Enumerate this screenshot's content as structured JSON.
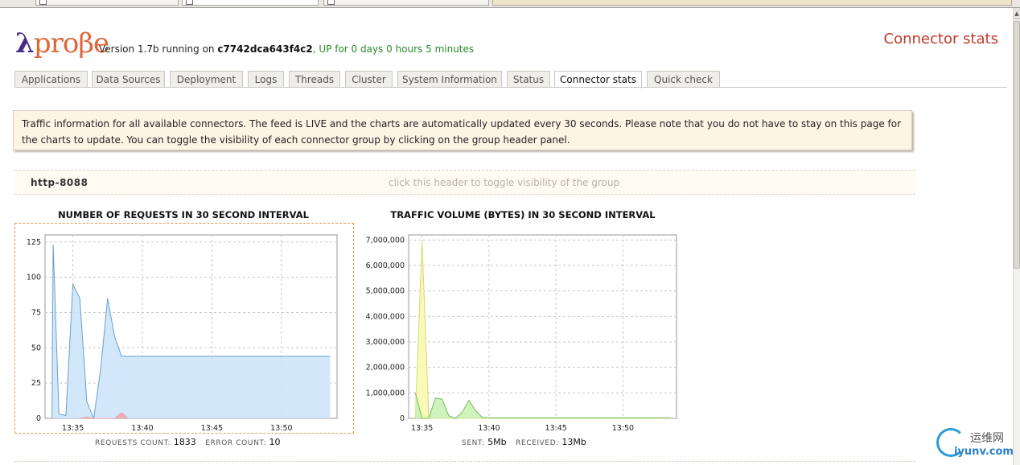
{
  "header": {
    "logo_lambda": "λ",
    "logo_rest": "proβe",
    "version_prefix": "Version 1.7b running on ",
    "host": "c7742dca643f4c2",
    "uptime": ", UP for 0 days 0 hours 5 minutes",
    "page_title": "Connector stats"
  },
  "tabs": [
    {
      "label": "Applications"
    },
    {
      "label": "Data Sources"
    },
    {
      "label": "Deployment"
    },
    {
      "label": "Logs"
    },
    {
      "label": "Threads"
    },
    {
      "label": "Cluster"
    },
    {
      "label": "System Information"
    },
    {
      "label": "Status"
    },
    {
      "label": "Connector stats",
      "active": true
    },
    {
      "label": "Quick check"
    }
  ],
  "info_text": "Traffic information for all available connectors. The feed is LIVE and the charts are automatically updated every 30 seconds. Please note that you do not have to stay on this page for the charts to update. You can toggle the visibility of each connector group by clicking on the group header panel.",
  "group": {
    "name": "http-8088",
    "hint": "click this header to toggle visibility of the group"
  },
  "requests_stats": {
    "count_label": "REQUESTS COUNT:",
    "count": "1833",
    "error_label": "ERROR COUNT:",
    "errors": "10"
  },
  "traffic_stats": {
    "sent_label": "SENT:",
    "sent": "5Mb",
    "received_label": "RECEIVED:",
    "received": "13Mb"
  },
  "colors": {
    "requests_fill": "#cde6fa",
    "requests_line": "#6aa0c8",
    "errors_fill": "#f0a0b0",
    "sent_fill": "#f8f8b0",
    "sent_line": "#d8d870",
    "received_fill": "#c8f0b0",
    "received_line": "#6cc060"
  },
  "chart_data": [
    {
      "type": "area",
      "title": "NUMBER OF REQUESTS IN 30 SECOND INTERVAL",
      "xlabel": "",
      "ylabel": "",
      "xlim": [
        "13:33",
        "13:54"
      ],
      "ylim": [
        0,
        130
      ],
      "yticks": [
        0,
        25,
        50,
        75,
        100,
        125
      ],
      "xticks": [
        "13:35",
        "13:40",
        "13:45",
        "13:50"
      ],
      "grid": true,
      "series": [
        {
          "points": [
            [
              "13:33:30",
              0
            ],
            [
              "13:33:35",
              123
            ],
            [
              "13:34:00",
              3
            ],
            [
              "13:34:30",
              2
            ],
            [
              "13:35:00",
              95
            ],
            [
              "13:35:30",
              85
            ],
            [
              "13:36:00",
              12
            ],
            [
              "13:36:30",
              0
            ],
            [
              "13:37:00",
              35
            ],
            [
              "13:37:30",
              85
            ],
            [
              "13:38:00",
              58
            ],
            [
              "13:38:30",
              44
            ],
            [
              "13:53:30",
              44
            ]
          ]
        },
        {
          "points": [
            [
              "13:35:30",
              0
            ],
            [
              "13:36:00",
              1
            ],
            [
              "13:36:30",
              0
            ],
            [
              "13:38:00",
              0
            ],
            [
              "13:38:30",
              4
            ],
            [
              "13:39:00",
              0
            ]
          ]
        }
      ]
    },
    {
      "type": "area",
      "title": "TRAFFIC VOLUME (BYTES) IN 30 SECOND INTERVAL",
      "xlabel": "",
      "ylabel": "",
      "xlim": [
        "13:34",
        "13:54"
      ],
      "ylim": [
        0,
        7200000
      ],
      "yticks": [
        0,
        1000000,
        2000000,
        3000000,
        4000000,
        5000000,
        6000000,
        7000000
      ],
      "ytick_labels": [
        "0",
        "1,000,000",
        "2,000,000",
        "3,000,000",
        "4,000,000",
        "5,000,000",
        "6,000,000",
        "7,000,000"
      ],
      "xticks": [
        "13:35",
        "13:40",
        "13:45",
        "13:50"
      ],
      "grid": true,
      "series": [
        {
          "points": [
            [
              "13:34:30",
              0
            ],
            [
              "13:35:00",
              7000000
            ],
            [
              "13:35:30",
              0
            ],
            [
              "13:53:30",
              0
            ]
          ]
        },
        {
          "points": [
            [
              "13:34:30",
              1000000
            ],
            [
              "13:35:00",
              0
            ],
            [
              "13:35:30",
              0
            ],
            [
              "13:36:00",
              800000
            ],
            [
              "13:36:30",
              750000
            ],
            [
              "13:37:00",
              100000
            ],
            [
              "13:37:30",
              0
            ],
            [
              "13:38:00",
              250000
            ],
            [
              "13:38:30",
              700000
            ],
            [
              "13:39:00",
              300000
            ],
            [
              "13:39:30",
              40000
            ],
            [
              "13:40:00",
              20000
            ],
            [
              "13:53:30",
              20000
            ]
          ]
        }
      ]
    }
  ]
}
